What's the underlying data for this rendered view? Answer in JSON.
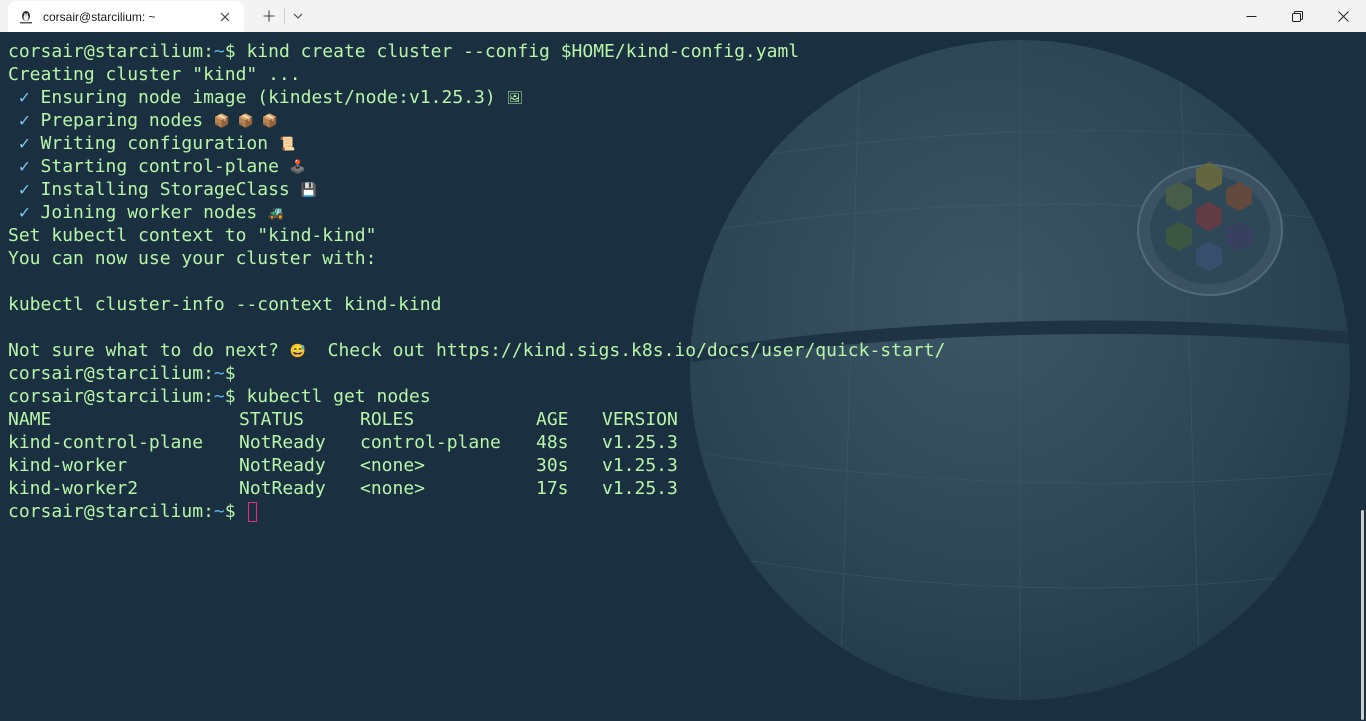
{
  "window": {
    "tab_title": "corsair@starcilium: ~",
    "new_tab_label": "+",
    "dropdown_label": "⌄",
    "close_label": "✕"
  },
  "colors": {
    "terminal_bg": "#1a3040",
    "text": "#b8f5a8",
    "path": "#5fb6e8",
    "cursor": "#e0307a"
  },
  "terminal": {
    "prompt_user": "corsair@starcilium:",
    "prompt_path": "~",
    "prompt_symbol": "$ ",
    "cmd1": "kind create cluster --config $HOME/kind-config.yaml",
    "creating": "Creating cluster \"kind\" ...",
    "check_mark": " ✓ ",
    "steps": [
      {
        "text": "Ensuring node image (kindest/node:v1.25.3) ",
        "emoji": "🖼"
      },
      {
        "text": "Preparing nodes ",
        "emoji": "📦 📦 📦"
      },
      {
        "text": "Writing configuration ",
        "emoji": "📜"
      },
      {
        "text": "Starting control-plane ",
        "emoji": "🕹️"
      },
      {
        "text": "Installing StorageClass ",
        "emoji": "💾"
      },
      {
        "text": "Joining worker nodes ",
        "emoji": "🚜"
      }
    ],
    "set_context": "Set kubectl context to \"kind-kind\"",
    "you_can": "You can now use your cluster with:",
    "cluster_info": "kubectl cluster-info --context kind-kind",
    "not_sure_pre": "Not sure what to do next? ",
    "not_sure_emoji": "😅",
    "not_sure_post": "  Check out https://kind.sigs.k8s.io/docs/user/quick-start/",
    "cmd2": "kubectl get nodes",
    "table_headers": [
      "NAME",
      "STATUS",
      "ROLES",
      "AGE",
      "VERSION"
    ],
    "rows": [
      [
        "kind-control-plane",
        "NotReady",
        "control-plane",
        "48s",
        "v1.25.3"
      ],
      [
        "kind-worker",
        "NotReady",
        "<none>",
        "30s",
        "v1.25.3"
      ],
      [
        "kind-worker2",
        "NotReady",
        "<none>",
        "17s",
        "v1.25.3"
      ]
    ]
  }
}
